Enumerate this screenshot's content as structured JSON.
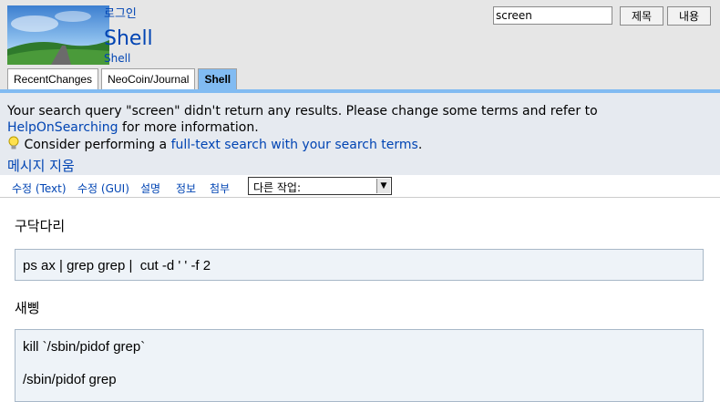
{
  "header": {
    "login": "로그인",
    "page_title": "Shell",
    "page_subtitle": "Shell",
    "search_value": "screen",
    "title_search_button": "제목",
    "content_search_button": "내용"
  },
  "navbar": {
    "tabs": [
      {
        "label": "RecentChanges",
        "current": false
      },
      {
        "label": "NeoCoin/Journal",
        "current": false
      },
      {
        "label": "Shell",
        "current": true
      }
    ]
  },
  "message": {
    "line1_before": "Your search query \"screen\" didn't return any results. Please change some terms and refer to ",
    "help_link": "HelpOnSearching",
    "line1_after": " for more information.",
    "line2_before": "Consider performing a ",
    "fulltext_link": "full-text search with your search terms",
    "line2_after": ".",
    "clear_link": "메시지 지움"
  },
  "editbar": {
    "edit_text": "수정 (Text)",
    "edit_gui": "수정 (GUI)",
    "comments": "설명",
    "info": "정보",
    "attachments": "첨부",
    "more_actions": "다른 작업:"
  },
  "content": {
    "heading1": "구닥다리",
    "code1": "ps ax | grep grep |  cut -d ' ' -f 2",
    "heading2": "새삥",
    "code2_line1": "kill `/sbin/pidof grep`",
    "code2_line2": "/sbin/pidof grep"
  },
  "colors": {
    "header_bg": "#e6e6e6",
    "accent": "#81bbf2",
    "link": "#0044b3",
    "message_bg": "#e6eaf0",
    "code_bg": "#eef3f8"
  },
  "icons": [
    "logo-image",
    "lightbulb-icon",
    "dropdown-arrow-icon"
  ]
}
